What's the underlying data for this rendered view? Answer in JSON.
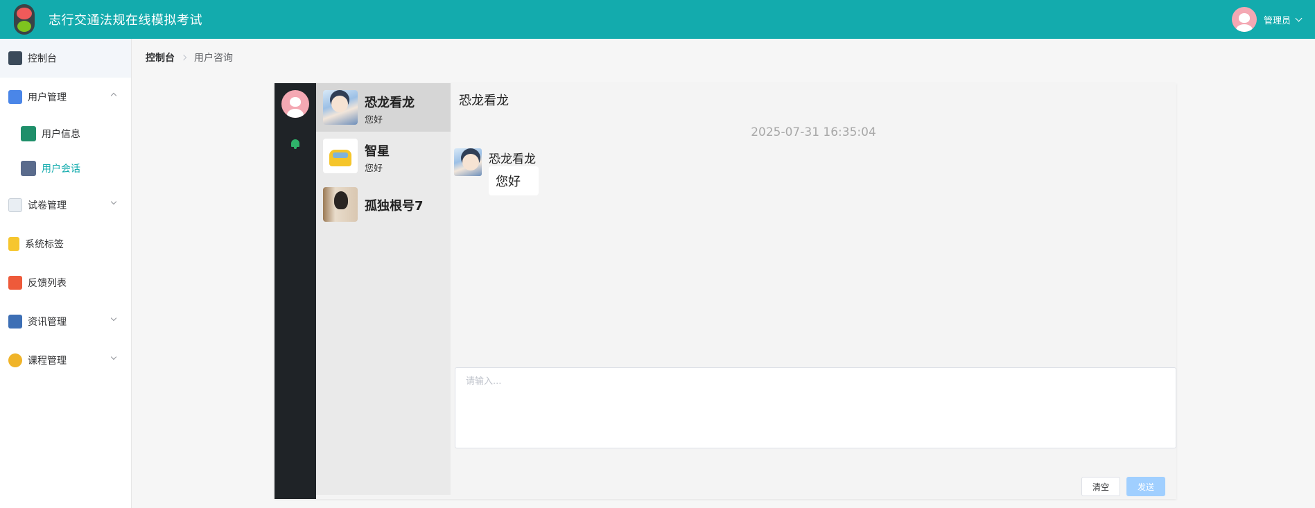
{
  "header": {
    "app_title": "志行交通法规在线模拟考试",
    "user_name": "管理员"
  },
  "breadcrumb": {
    "home": "控制台",
    "current": "用户咨询"
  },
  "sidebar": {
    "items": [
      {
        "label": "控制台"
      },
      {
        "label": "用户管理",
        "children": [
          {
            "label": "用户信息"
          },
          {
            "label": "用户会话"
          }
        ]
      },
      {
        "label": "试卷管理"
      },
      {
        "label": "系统标签"
      },
      {
        "label": "反馈列表"
      },
      {
        "label": "资讯管理"
      },
      {
        "label": "课程管理"
      }
    ]
  },
  "conversations": [
    {
      "name": "恐龙看龙",
      "last": "您好"
    },
    {
      "name": "智星",
      "last": "您好"
    },
    {
      "name": "孤独根号7",
      "last": ""
    }
  ],
  "chat": {
    "title": "恐龙看龙",
    "time": "2025-07-31 16:35:04",
    "sender": "恐龙看龙",
    "message": "您好",
    "input_placeholder": "请输入...",
    "clear_label": "清空",
    "send_label": "发送"
  },
  "colors": {
    "header_bg": "#13abad",
    "active_menu": "#13abad",
    "rail_bg": "#1f2327",
    "send_button": "#a0cfff"
  }
}
